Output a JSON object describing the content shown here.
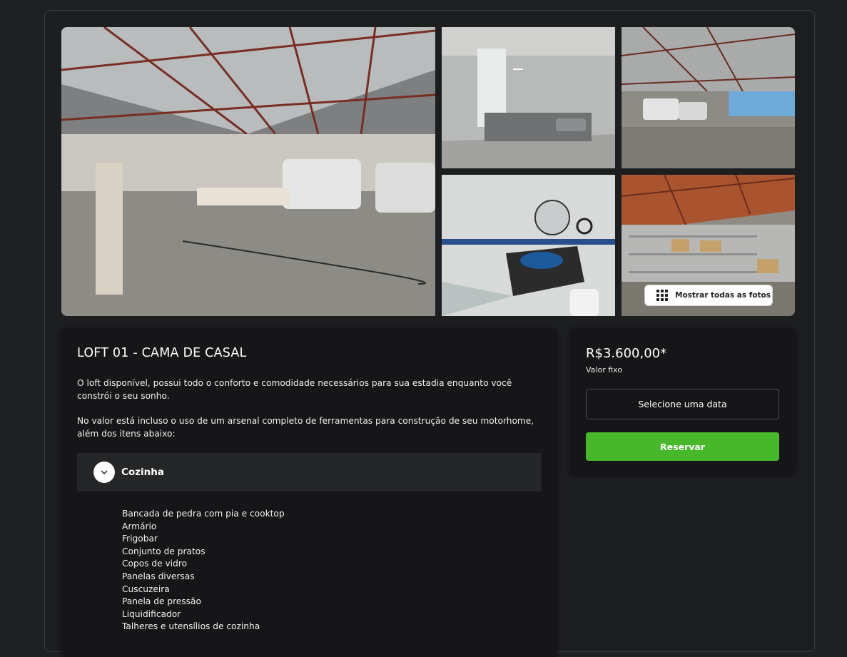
{
  "gallery": {
    "photos": [
      {
        "alt": "warehouse-workshop"
      },
      {
        "alt": "bedroom"
      },
      {
        "alt": "covered-garage"
      },
      {
        "alt": "bathroom"
      },
      {
        "alt": "storage-shelves"
      }
    ],
    "show_all_label": "Mostrar todas as fotos"
  },
  "listing": {
    "title": "LOFT 01 - CAMA DE CASAL",
    "description_1": "O loft disponível, possui todo o conforto e comodidade necessários para sua estadia enquanto você constrói o seu sonho.",
    "description_2": "No valor está incluso o uso de um arsenal completo de ferramentas para construção de seu motorhome, além dos itens abaixo:",
    "accordion": {
      "title": "Cozinha",
      "items": [
        "Bancada de pedra com pia e cooktop",
        "Armário",
        "Frigobar",
        "Conjunto de pratos",
        "Copos de vidro",
        "Panelas diversas",
        "Cuscuzeira",
        "Panela de pressão",
        "Liquidificador",
        "Talheres e utensílios de cozinha"
      ]
    }
  },
  "booking": {
    "price": "R$3.600,00*",
    "price_note": "Valor fixo",
    "date_button": "Selecione uma data",
    "reserve_button": "Reservar",
    "accent_color": "#46b82a"
  }
}
